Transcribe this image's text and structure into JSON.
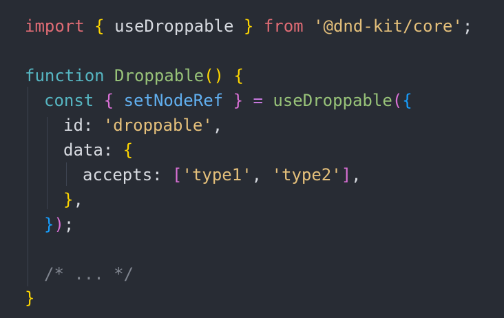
{
  "code": {
    "l1": {
      "kw_import": "import",
      "open_brace": "{",
      "name": "useDroppable",
      "close_brace": "}",
      "kw_from": "from",
      "module": "'@dnd-kit/core'",
      "semi": ";"
    },
    "l3": {
      "kw_function": "function",
      "name": "Droppable",
      "parens": "()",
      "brace": "{"
    },
    "l4": {
      "kw_const": "const",
      "open_brace": "{",
      "var": "setNodeRef",
      "close_brace": "}",
      "eq": "=",
      "call": "useDroppable",
      "open_paren": "(",
      "open_obj": "{"
    },
    "l5": {
      "key": "id:",
      "value": "'droppable'",
      "comma": ","
    },
    "l6": {
      "key": "data:",
      "brace": "{"
    },
    "l7": {
      "key": "accepts:",
      "open_bracket": "[",
      "item1": "'type1'",
      "sep": ",",
      "item2": "'type2'",
      "close_bracket": "]",
      "comma": ","
    },
    "l8": {
      "brace": "}",
      "comma": ","
    },
    "l9": {
      "brace": "}",
      "paren": ")",
      "semi": ";"
    },
    "l11": {
      "comment": "/* ... */"
    },
    "l12": {
      "brace": "}"
    }
  }
}
